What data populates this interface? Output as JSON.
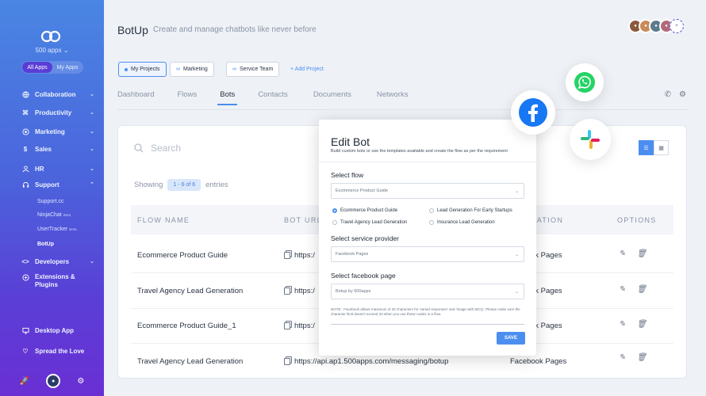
{
  "sidebar": {
    "apps_label": "500 apps",
    "toggle": [
      "All Apps",
      "My Apps"
    ],
    "nav": [
      {
        "label": "Collaboration",
        "icon": "globe-icon"
      },
      {
        "label": "Productivity",
        "icon": "command-icon"
      },
      {
        "label": "Marketing",
        "icon": "target-icon"
      },
      {
        "label": "Sales",
        "icon": "dollar-icon"
      },
      {
        "label": "HR",
        "icon": "user-icon"
      },
      {
        "label": "Support",
        "icon": "headset-icon"
      }
    ],
    "support_items": [
      {
        "label": "Support.cc",
        "badge": ""
      },
      {
        "label": "NinjaChat",
        "badge": "Beta"
      },
      {
        "label": "UserTracker",
        "badge": "Beta"
      },
      {
        "label": "BotUp",
        "badge": ""
      }
    ],
    "nav2": [
      {
        "label": "Developers",
        "icon": "code-icon"
      },
      {
        "label": "Extensions &",
        "label2": "Plugins",
        "icon": "puzzle-icon"
      }
    ],
    "bottom": [
      {
        "label": "Desktop App",
        "icon": "monitor-icon"
      },
      {
        "label": "Spread the Love",
        "icon": "heart-icon"
      }
    ]
  },
  "header": {
    "title": "BotUp",
    "subtitle": "Create and manage chatbots like never before"
  },
  "projects": [
    "My Projects",
    "Marketing",
    "Service Team"
  ],
  "add_project": "+ Add Project",
  "tabs": [
    "Dashboard",
    "Flows",
    "Bots",
    "Contacts",
    "Documents",
    "Networks"
  ],
  "table": {
    "search_placeholder": "Search",
    "showing_prefix": "Showing",
    "showing_range": "1 - 6 of 6",
    "showing_suffix": "entries",
    "columns": [
      "FLOW NAME",
      "BOT URL",
      "RATION",
      "OPTIONS"
    ],
    "rows": [
      {
        "flow": "Ecommerce Product Guide",
        "url": "https:/",
        "network": "ok Pages"
      },
      {
        "flow": "Travel Agency Lead Generation",
        "url": "https:/",
        "network": "ok Pages"
      },
      {
        "flow": "Ecommerce Product Guide_1",
        "url": "https:/",
        "network": "ok Pages"
      },
      {
        "flow": "Travel Agency Lead Generation",
        "url": "https://api.ap1.500apps.com/messaging/botup",
        "network": "Facebook Pages"
      }
    ]
  },
  "modal": {
    "title": "Edit Bot",
    "description": "Build custom bots or use the templates available and create the flow as per the requirement",
    "flow_label": "Select flow",
    "flow_value": "Ecommerce Product Guide",
    "radios": [
      "Ecommerce Product Guide",
      "Lead Generation For Early Startups",
      "Travel Agency Lead Generation",
      "Insurance Lead Generation"
    ],
    "provider_label": "Select service provider",
    "provider_value": "Facebook Pages",
    "page_label": "Select facebook page",
    "page_value": "Botup by 500apps",
    "note": "NOTE : Facebook allows maximum of 20 characters for 'varied responses' and 'image with MCQ'. Please make sure the character limit doesn't exceed 20 when you use these nodes in a flow.",
    "save_label": "SAVE"
  },
  "colors": {
    "accent": "#4b8ef0",
    "whatsapp": "#25d366",
    "facebook": "#1877f2"
  }
}
